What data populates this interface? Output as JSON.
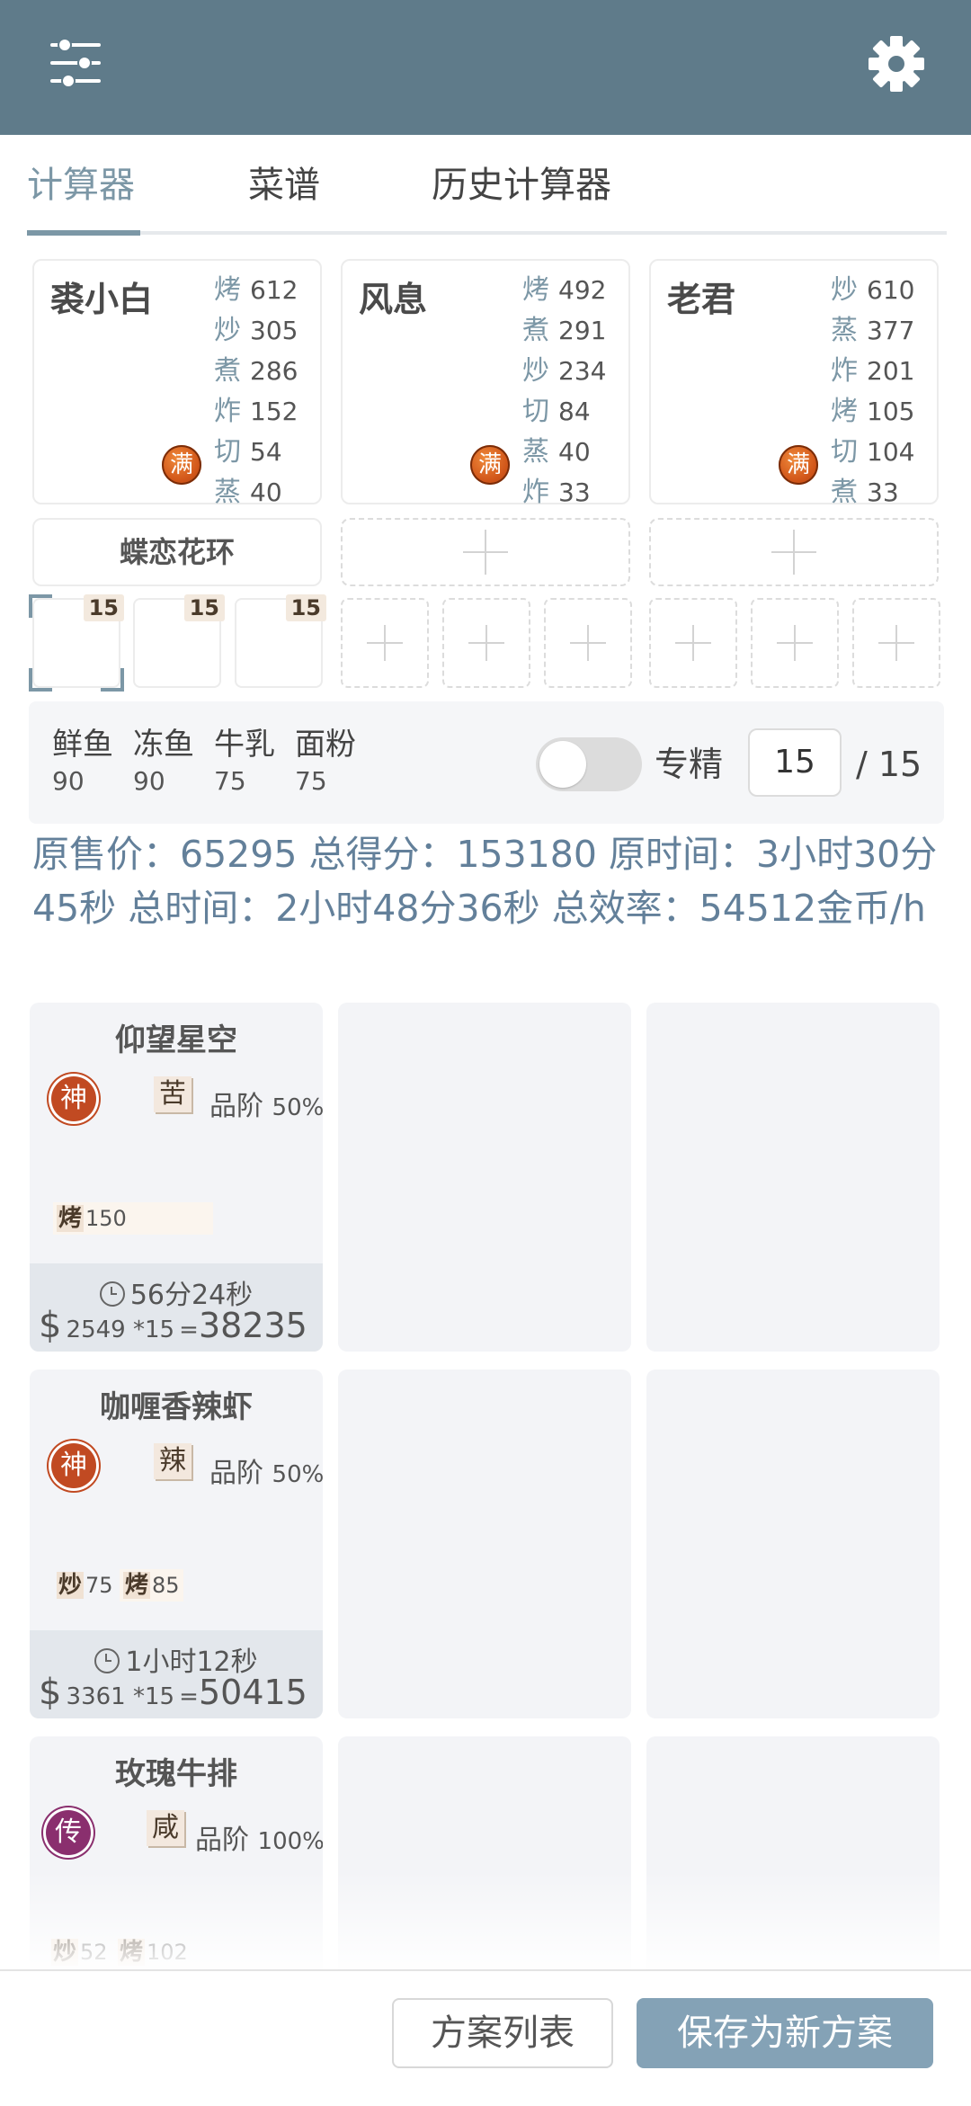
{
  "header": {
    "menu_icon": "sliders-icon",
    "settings_icon": "gear-icon",
    "color": "#5f7b8a"
  },
  "tabs": [
    {
      "label": "计算器",
      "active": true
    },
    {
      "label": "菜谱"
    },
    {
      "label": "历史计算器"
    }
  ],
  "chefs": [
    {
      "name": "裘小白",
      "badge": "满",
      "skills": [
        {
          "k": "烤",
          "v": "612"
        },
        {
          "k": "炒",
          "v": "305"
        },
        {
          "k": "煮",
          "v": "286"
        },
        {
          "k": "炸",
          "v": "152"
        },
        {
          "k": "切",
          "v": "54"
        },
        {
          "k": "蒸",
          "v": "40"
        }
      ]
    },
    {
      "name": "风息",
      "badge": "满",
      "skills": [
        {
          "k": "烤",
          "v": "492"
        },
        {
          "k": "煮",
          "v": "291"
        },
        {
          "k": "炒",
          "v": "234"
        },
        {
          "k": "切",
          "v": "84"
        },
        {
          "k": "蒸",
          "v": "40"
        },
        {
          "k": "炸",
          "v": "33"
        }
      ]
    },
    {
      "name": "老君",
      "badge": "满",
      "skills": [
        {
          "k": "炒",
          "v": "610"
        },
        {
          "k": "蒸",
          "v": "377"
        },
        {
          "k": "炸",
          "v": "201"
        },
        {
          "k": "烤",
          "v": "105"
        },
        {
          "k": "切",
          "v": "104"
        },
        {
          "k": "煮",
          "v": "33"
        }
      ]
    }
  ],
  "equipment": {
    "chef0": "蝶恋花环"
  },
  "slots": [
    {
      "badge": "15"
    },
    {
      "badge": "15"
    },
    {
      "badge": "15"
    }
  ],
  "ingredients": [
    {
      "name": "鲜鱼",
      "qty": "90"
    },
    {
      "name": "冻鱼",
      "qty": "90"
    },
    {
      "name": "牛乳",
      "qty": "75"
    },
    {
      "name": "面粉",
      "qty": "75"
    }
  ],
  "specialize": {
    "label": "专精",
    "value": "15",
    "max": "/ 15",
    "enabled": false
  },
  "summary": "原售价：65295 总得分：153180 原时间：3小时30分45秒 总时间：2小时48分36秒 总效率：54512金币/h",
  "recipes": [
    {
      "name": "仰望星空",
      "rank": "神",
      "rank_color": "#c14a22",
      "taste": "苦",
      "quality": "品阶",
      "quality_pct": "50%",
      "reqs": [
        {
          "k": "烤",
          "v": "150"
        }
      ],
      "time": "56分24秒",
      "price": "2549 *15",
      "eq": "=",
      "total": "38235"
    },
    {
      "name": "咖喱香辣虾",
      "rank": "神",
      "rank_color": "#c14a22",
      "taste": "辣",
      "quality": "品阶",
      "quality_pct": "50%",
      "reqs": [
        {
          "k": "炒",
          "v": "75"
        },
        {
          "k": "烤",
          "v": "85"
        }
      ],
      "time": "1小时12秒",
      "price": "3361 *15",
      "eq": "=",
      "total": "50415"
    },
    {
      "name": "玫瑰牛排",
      "rank": "传",
      "rank_color": "#8a2f6e",
      "taste": "咸",
      "quality": "品阶",
      "quality_pct": "100%",
      "reqs": [
        {
          "k": "炒",
          "v": "52"
        },
        {
          "k": "烤",
          "v": "102"
        }
      ],
      "time": "",
      "price": "",
      "eq": "",
      "total": ""
    }
  ],
  "currency_symbol": "$",
  "buttons": {
    "plan_list": "方案列表",
    "save_new": "保存为新方案"
  }
}
